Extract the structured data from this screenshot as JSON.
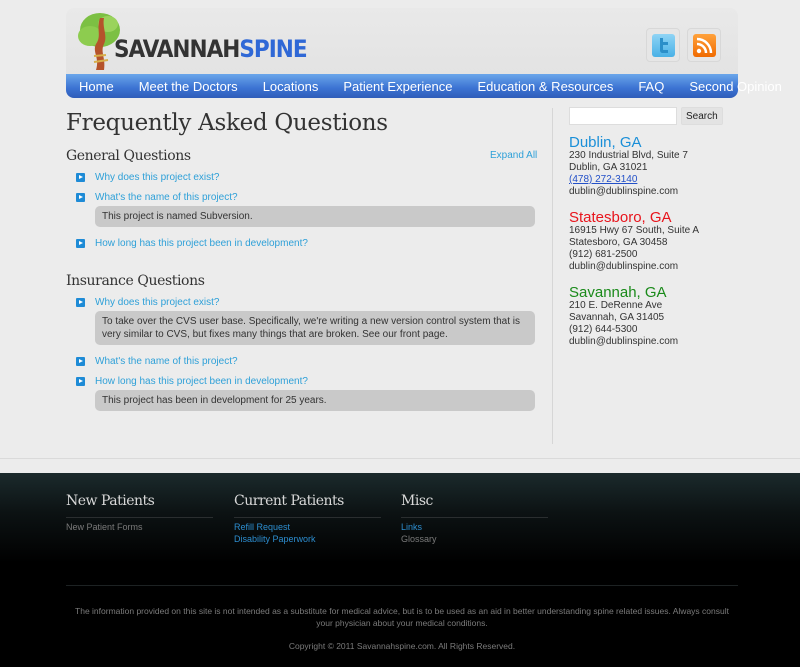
{
  "header": {
    "logo": {
      "part1": "SAVANNAH",
      "part2": "SPINE"
    },
    "social": [
      {
        "name": "twitter",
        "icon": "twitter-icon"
      },
      {
        "name": "rss",
        "icon": "rss-icon"
      }
    ]
  },
  "nav": {
    "items": [
      "Home",
      "Meet the Doctors",
      "Locations",
      "Patient Experience",
      "Education & Resources",
      "FAQ",
      "Second Opinion"
    ]
  },
  "main": {
    "title": "Frequently Asked Questions",
    "expand_all": "Expand All",
    "sections": [
      {
        "title": "General Questions",
        "items": [
          {
            "q": "Why does this project exist?",
            "a": null
          },
          {
            "q": "What's the name of this project?",
            "a": "This project is named Subversion."
          },
          {
            "q": "How long has this project been in development?",
            "a": null
          }
        ]
      },
      {
        "title": "Insurance Questions",
        "items": [
          {
            "q": "Why does this project exist?",
            "a": "To take over the CVS user base. Specifically, we're writing a new version control system that is very similar to CVS, but fixes many things that are broken. See our front page."
          },
          {
            "q": "What's the name of this project?",
            "a": null
          },
          {
            "q": "How long has this project been in development?",
            "a": "This project has been in development for 25 years."
          }
        ]
      }
    ]
  },
  "sidebar": {
    "search": {
      "placeholder": "",
      "value": "",
      "button": "Search"
    },
    "locations": [
      {
        "name": "Dublin, GA",
        "color": "#1a8fd8",
        "address1": "230 Industrial Blvd, Suite 7",
        "address2": "Dublin, GA 31021",
        "phone": "(478) 272-3140",
        "phone_link": true,
        "email": "dublin@dublinspine.com"
      },
      {
        "name": "Statesboro, GA",
        "color": "#e8141c",
        "address1": "16915 Hwy 67 South, Suite A",
        "address2": "Statesboro, GA 30458",
        "phone": "(912) 681-2500",
        "phone_link": false,
        "email": "dublin@dublinspine.com"
      },
      {
        "name": "Savannah, GA",
        "color": "#1a8a1a",
        "address1": "210 E. DeRenne Ave",
        "address2": "Savannah, GA 31405",
        "phone": "(912) 644-5300",
        "phone_link": false,
        "email": "dublin@dublinspine.com"
      }
    ]
  },
  "footer": {
    "columns": [
      {
        "title": "New Patients",
        "links": [
          {
            "label": "New Patient Forms",
            "style": "gray"
          }
        ]
      },
      {
        "title": "Current Patients",
        "links": [
          {
            "label": "Refill Request",
            "style": "blue"
          },
          {
            "label": "Disability Paperwork",
            "style": "blue"
          }
        ]
      },
      {
        "title": "Misc",
        "links": [
          {
            "label": "Links",
            "style": "blue"
          },
          {
            "label": "Glossary",
            "style": "gray"
          }
        ]
      }
    ],
    "disclaimer": "The information provided on this site is not intended as a substitute for medical advice, but is to be used as an aid in better understanding spine related issues. Always consult your physician about your medical conditions.",
    "copyright": "Copyright © 2011 Savannahspine.com. All Rights Reserved."
  }
}
